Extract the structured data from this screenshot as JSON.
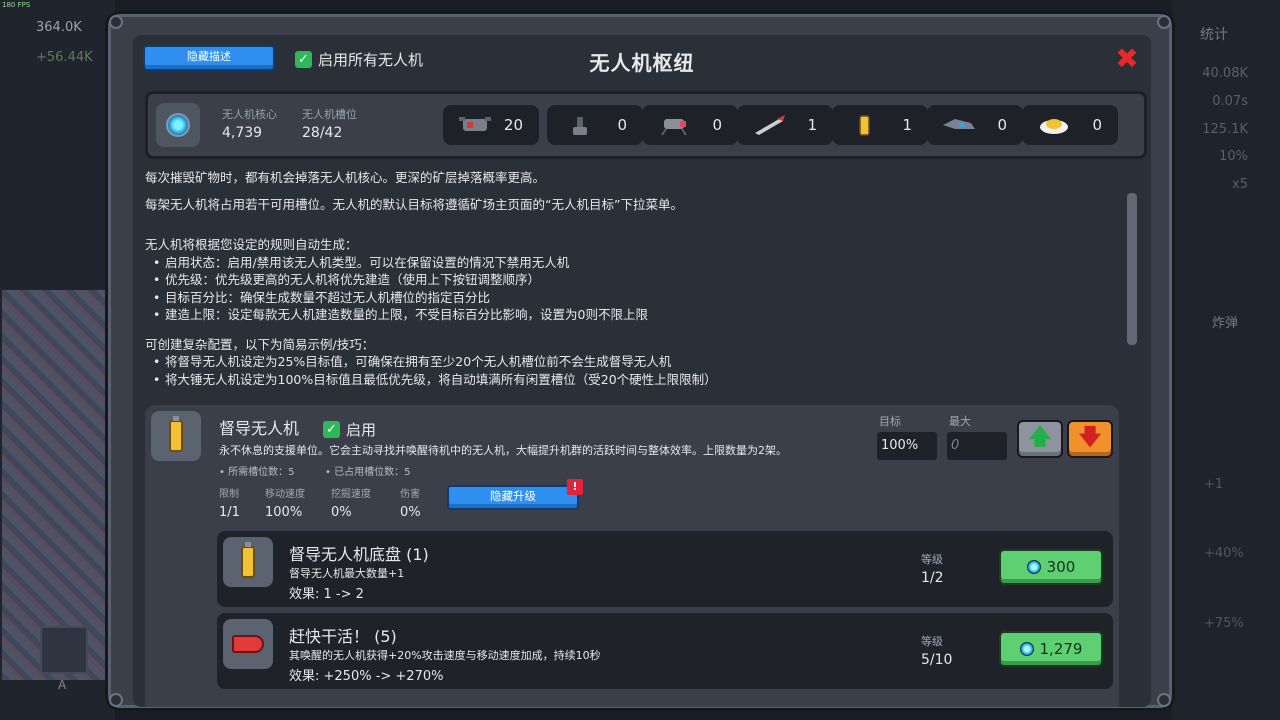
{
  "background": {
    "fps": "180 FPS",
    "left_stats": [
      "364.0K",
      "+56.44K"
    ],
    "right_tab": "统计",
    "right_stats": [
      "40.08K",
      "0.07s",
      "125.1K",
      "10%",
      "x5"
    ],
    "bomb_label": "炸弹",
    "right_plus": [
      "+1",
      "+40%",
      "+75%"
    ],
    "slot_letter": "A"
  },
  "header": {
    "hide_desc_label": "隐藏描述",
    "enable_all_label": "启用所有无人机",
    "title": "无人机枢纽",
    "close_icon": "close-x-icon"
  },
  "stats": {
    "cores_label": "无人机核心",
    "cores_value": "4,739",
    "slots_label": "无人机槽位",
    "slots_value": "28/42",
    "drones": [
      {
        "icon": "combat-drone-icon",
        "count": "20"
      },
      {
        "icon": "turret-drone-icon",
        "count": "0"
      },
      {
        "icon": "spider-drone-icon",
        "count": "0"
      },
      {
        "icon": "drill-drone-icon",
        "count": "1"
      },
      {
        "icon": "supervisor-drone-icon",
        "count": "1"
      },
      {
        "icon": "jet-drone-icon",
        "count": "0"
      },
      {
        "icon": "hammer-drone-icon",
        "count": "0"
      }
    ]
  },
  "description": {
    "p1": "每次摧毁矿物时，都有机会掉落无人机核心。更深的矿层掉落概率更高。",
    "p2": "每架无人机将占用若干可用槽位。无人机的默认目标将遵循矿场主页面的“无人机目标”下拉菜单。",
    "rules_intro": "无人机将根据您设定的规则自动生成：",
    "rules": [
      "启用状态：启用/禁用该无人机类型。可以在保留设置的情况下禁用无人机",
      "优先级：优先级更高的无人机将优先建造（使用上下按钮调整顺序）",
      "目标百分比：确保生成数量不超过无人机槽位的指定百分比",
      "建造上限：设定每款无人机建造数量的上限，不受目标百分比影响，设置为0则不限上限"
    ],
    "tips_intro": "可创建复杂配置，以下为简易示例/技巧：",
    "tips": [
      "将督导无人机设定为25%目标值，可确保在拥有至少20个无人机槽位前不会生成督导无人机",
      "将大锤无人机设定为100%目标值且最低优先级，将自动填满所有闲置槽位（受20个硬性上限限制）"
    ]
  },
  "drone_card": {
    "name": "督导无人机",
    "enable_label": "启用",
    "desc": "永不休息的支援单位。它会主动寻找并唤醒待机中的无人机，大幅提升机群的活跃时间与整体效率。上限数量为2架。",
    "slots_required": "• 所需槽位数：5",
    "slots_occupied": "• 已占用槽位数：5",
    "stats": [
      {
        "label": "限制",
        "value": "1/1"
      },
      {
        "label": "移动速度",
        "value": "100%"
      },
      {
        "label": "挖掘速度",
        "value": "0%"
      },
      {
        "label": "伤害",
        "value": "0%"
      }
    ],
    "hide_upgrades_label": "隐藏升级",
    "alert": "!",
    "target_label": "目标",
    "target_value": "100%",
    "max_label": "最大",
    "max_placeholder": "0",
    "up_arrow": "🡅",
    "down_arrow": "🡇"
  },
  "upgrades": [
    {
      "name": "督导无人机底盘 (1)",
      "desc": "督导无人机最大数量+1",
      "effect": "效果: 1 -> 2",
      "level_label": "等级",
      "level": "1/2",
      "cost": "300"
    },
    {
      "name": "赶快干活！ (5)",
      "desc": "其唤醒的无人机获得+20%攻击速度与移动速度加成，持续10秒",
      "effect": "效果: +250% -> +270%",
      "level_label": "等级",
      "level": "5/10",
      "cost": "1,279"
    }
  ]
}
